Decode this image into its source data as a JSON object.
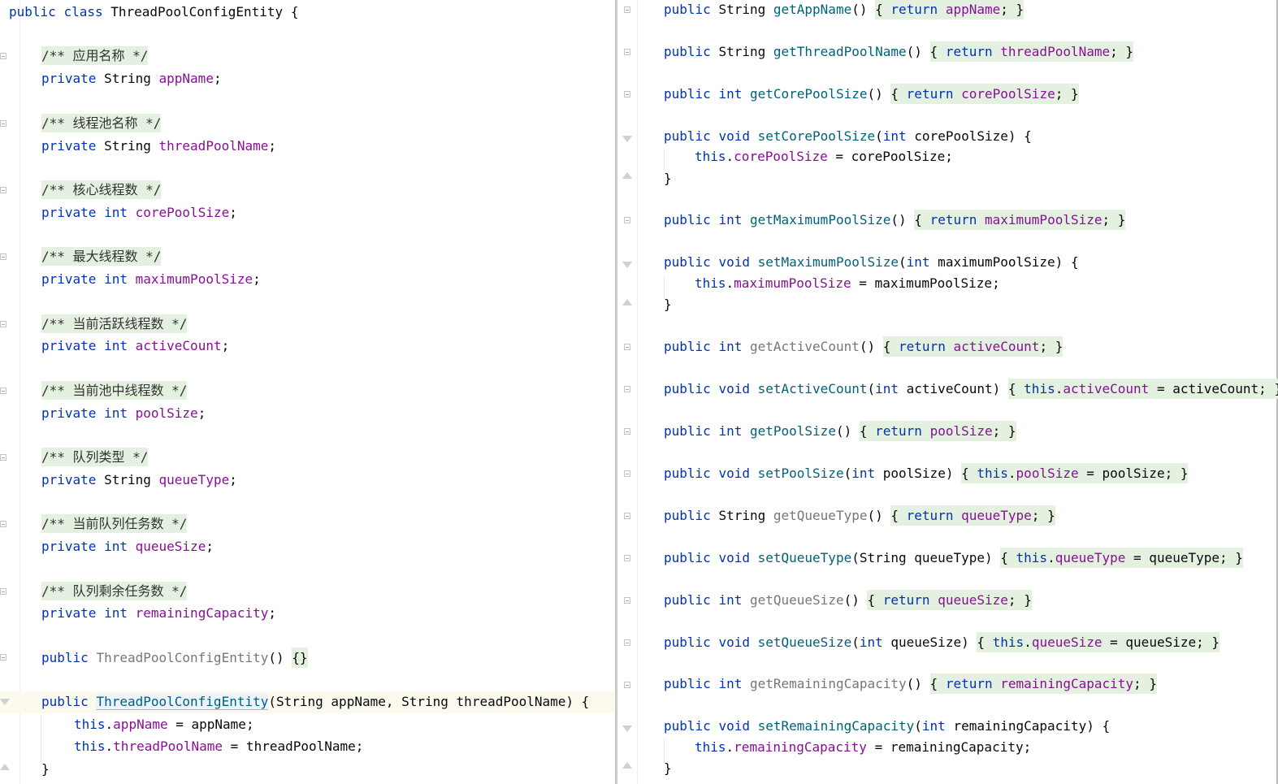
{
  "left_editor": {
    "class_decl": {
      "kw1": "public",
      "kw2": "class",
      "name": "ThreadPoolConfigEntity",
      "brace": "{"
    },
    "fields": [
      {
        "comment": "/** 应用名称 */",
        "modifier": "private",
        "type": "String",
        "name": "appName"
      },
      {
        "comment": "/** 线程池名称 */",
        "modifier": "private",
        "type": "String",
        "name": "threadPoolName"
      },
      {
        "comment": "/** 核心线程数 */",
        "modifier": "private",
        "type": "int",
        "name": "corePoolSize"
      },
      {
        "comment": "/** 最大线程数 */",
        "modifier": "private",
        "type": "int",
        "name": "maximumPoolSize"
      },
      {
        "comment": "/** 当前活跃线程数 */",
        "modifier": "private",
        "type": "int",
        "name": "activeCount"
      },
      {
        "comment": "/** 当前池中线程数 */",
        "modifier": "private",
        "type": "int",
        "name": "poolSize"
      },
      {
        "comment": "/** 队列类型 */",
        "modifier": "private",
        "type": "String",
        "name": "queueType"
      },
      {
        "comment": "/** 当前队列任务数 */",
        "modifier": "private",
        "type": "int",
        "name": "queueSize"
      },
      {
        "comment": "/** 队列剩余任务数 */",
        "modifier": "private",
        "type": "int",
        "name": "remainingCapacity"
      }
    ],
    "default_ctor": {
      "kw": "public",
      "name": "ThreadPoolConfigEntity",
      "parens": "()",
      "body": "{}"
    },
    "full_ctor": {
      "kw": "public",
      "name": "ThreadPoolConfigEntity",
      "params": "(String appName, String threadPoolName) {",
      "line1": {
        "this": "this",
        "field": "appName",
        "rest": " = appName;"
      },
      "line2": {
        "this": "this",
        "field": "threadPoolName",
        "rest": " = threadPoolName;"
      },
      "close": "}"
    }
  },
  "right_editor": {
    "getAppName": {
      "kw": "public",
      "type": "String",
      "name": "getAppName",
      "parens": "()",
      "return_kw": "return",
      "field": "appName"
    },
    "getThreadPoolName": {
      "kw": "public",
      "type": "String",
      "name": "getThreadPoolName",
      "parens": "()",
      "return_kw": "return",
      "field": "threadPoolName"
    },
    "getCorePoolSize": {
      "kw": "public",
      "type": "int",
      "name": "getCorePoolSize",
      "parens": "()",
      "return_kw": "return",
      "field": "corePoolSize"
    },
    "setCorePoolSize": {
      "kw": "public",
      "type": "void",
      "name": "setCorePoolSize",
      "param_type": "int",
      "param_rest": " corePoolSize) {",
      "body_this": "this",
      "body_field": "corePoolSize",
      "body_rest": " = corePoolSize;",
      "close": "}"
    },
    "getMaximumPoolSize": {
      "kw": "public",
      "type": "int",
      "name": "getMaximumPoolSize",
      "parens": "()",
      "return_kw": "return",
      "field": "maximumPoolSize"
    },
    "setMaximumPoolSize": {
      "kw": "public",
      "type": "void",
      "name": "setMaximumPoolSize",
      "param_type": "int",
      "param_rest": " maximumPoolSize) {",
      "body_this": "this",
      "body_field": "maximumPoolSize",
      "body_rest": " = maximumPoolSize;",
      "close": "}"
    },
    "getActiveCount": {
      "kw": "public",
      "type": "int",
      "name": "getActiveCount",
      "parens": "()",
      "return_kw": "return",
      "field": "activeCount"
    },
    "setActiveCount": {
      "kw": "public",
      "type": "void",
      "name": "setActiveCount",
      "param_type": "int",
      "param_rest": " activeCount)",
      "this_kw": "this",
      "field": "activeCount",
      "rest": " = activeCount;"
    },
    "getPoolSize": {
      "kw": "public",
      "type": "int",
      "name": "getPoolSize",
      "parens": "()",
      "return_kw": "return",
      "field": "poolSize"
    },
    "setPoolSize": {
      "kw": "public",
      "type": "void",
      "name": "setPoolSize",
      "param_type": "int",
      "param_rest": " poolSize)",
      "this_kw": "this",
      "field": "poolSize",
      "rest": " = poolSize;"
    },
    "getQueueType": {
      "kw": "public",
      "type": "String",
      "name": "getQueueType",
      "parens": "()",
      "return_kw": "return",
      "field": "queueType"
    },
    "setQueueType": {
      "kw": "public",
      "type": "void",
      "name": "setQueueType",
      "param_type": "String",
      "param_rest": " queueType)",
      "this_kw": "this",
      "field": "queueType",
      "rest": " = queueType;"
    },
    "getQueueSize": {
      "kw": "public",
      "type": "int",
      "name": "getQueueSize",
      "parens": "()",
      "return_kw": "return",
      "field": "queueSize"
    },
    "setQueueSize": {
      "kw": "public",
      "type": "void",
      "name": "setQueueSize",
      "param_type": "int",
      "param_rest": " queueSize)",
      "this_kw": "this",
      "field": "queueSize",
      "rest": " = queueSize;"
    },
    "getRemainingCapacity": {
      "kw": "public",
      "type": "int",
      "name": "getRemainingCapacity",
      "parens": "()",
      "return_kw": "return",
      "field": "remainingCapacity"
    },
    "setRemainingCapacity": {
      "kw": "public",
      "type": "void",
      "name": "setRemainingCapacity",
      "param_type": "int",
      "param_rest": " remainingCapacity) {",
      "body_this": "this",
      "body_field": "remainingCapacity",
      "body_rest": " = remainingCapacity;",
      "close": "}"
    },
    "brace_open": "{",
    "brace_close": "}",
    "semicolon": ";",
    "dot": "."
  }
}
